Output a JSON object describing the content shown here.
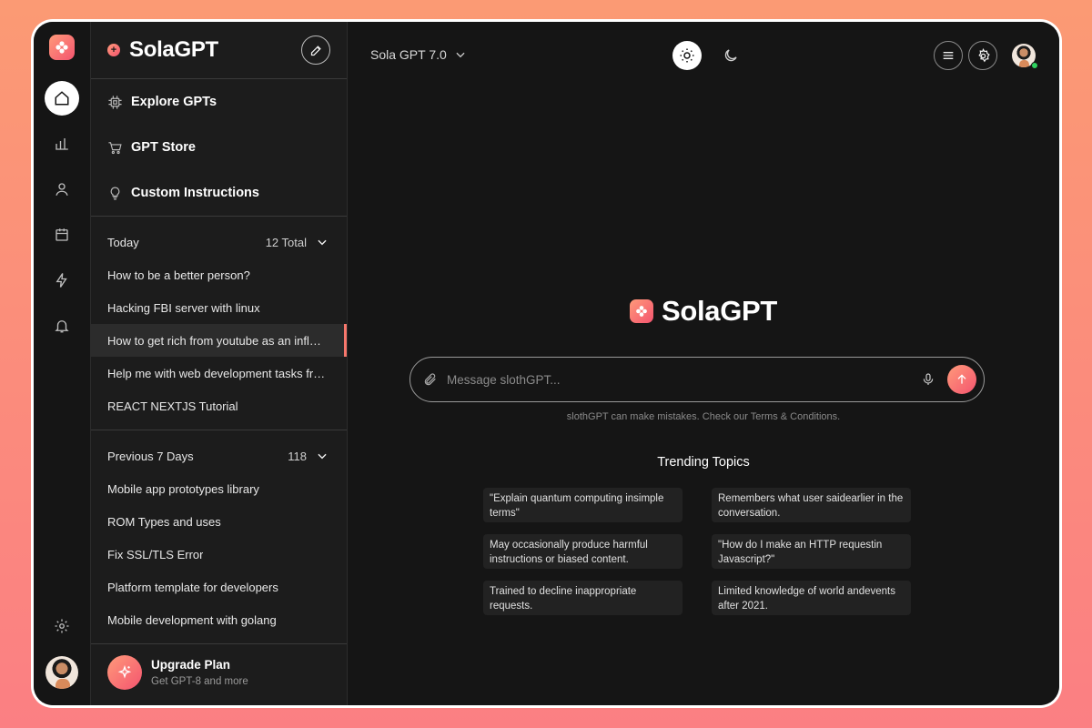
{
  "brand": {
    "name": "SolaGPT"
  },
  "rail": {
    "items": [
      "home-icon",
      "chart-icon",
      "user-icon",
      "calendar-icon",
      "bolt-icon",
      "bell-icon"
    ],
    "bottom": [
      "gear-icon",
      "avatar"
    ]
  },
  "sidebar": {
    "nav": [
      {
        "label": "Explore GPTs",
        "icon": "chip-icon"
      },
      {
        "label": "GPT Store",
        "icon": "cart-icon"
      },
      {
        "label": "Custom Instructions",
        "icon": "bulb-icon"
      }
    ],
    "today": {
      "label": "Today",
      "count": "12 Total",
      "items": [
        "How to be a better person?",
        "Hacking FBI server with linux",
        "How to get rich from youtube as an influencer",
        "Help me with web development tasks from scratch",
        "REACT NEXTJS Tutorial"
      ]
    },
    "previous": {
      "label": "Previous 7 Days",
      "count": "118",
      "items": [
        "Mobile app prototypes library",
        "ROM Types and uses",
        "Fix SSL/TLS Error",
        "Platform template for developers",
        "Mobile development with golang"
      ]
    },
    "upgrade": {
      "title": "Upgrade Plan",
      "subtitle": "Get GPT-8 and more"
    }
  },
  "header": {
    "model": "Sola GPT 7.0"
  },
  "composer": {
    "placeholder": "Message slothGPT...",
    "disclaimer": "slothGPT can make mistakes. Check our Terms & Conditions."
  },
  "trending": {
    "title": "Trending Topics",
    "topics": [
      "\"Explain quantum computing insimple terms\"",
      "Remembers what user saidearlier in the conversation.",
      "May occasionally produce harmful instructions or biased content.",
      "\"How do I make an HTTP requestin Javascript?\"",
      "Trained to decline inappropriate requests.",
      "Limited knowledge of world andevents after 2021."
    ]
  },
  "colors": {
    "accent": "#f4546f",
    "accent_light": "#ff9a7a",
    "background": "#151515",
    "sidebar": "#1c1c1c",
    "online": "#2fd35f"
  }
}
